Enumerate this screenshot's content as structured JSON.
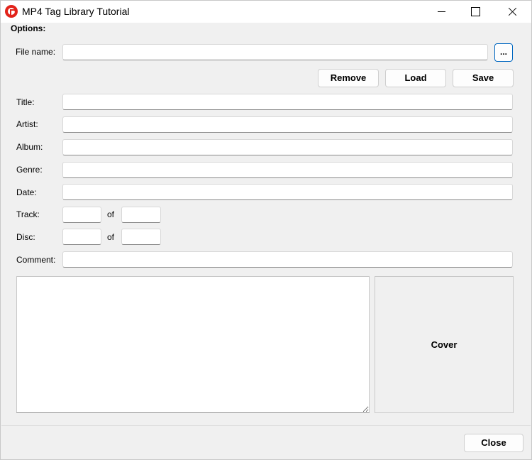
{
  "window": {
    "title": "MP4 Tag Library Tutorial",
    "minimize_icon": "minimize-icon",
    "maximize_icon": "maximize-icon",
    "close_icon": "close-icon"
  },
  "options": {
    "group_label": "Options:",
    "file_name_label": "File name:",
    "file_name_value": "",
    "browse_label": "...",
    "remove_label": "Remove",
    "load_label": "Load",
    "save_label": "Save"
  },
  "tags": {
    "title_label": "Title:",
    "artist_label": "Artist:",
    "album_label": "Album:",
    "genre_label": "Genre:",
    "date_label": "Date:",
    "track_label": "Track:",
    "track_of_label": "of",
    "disc_label": "Disc:",
    "disc_of_label": "of",
    "comment_label": "Comment:"
  },
  "cover": {
    "label": "Cover"
  },
  "footer": {
    "close_label": "Close"
  }
}
